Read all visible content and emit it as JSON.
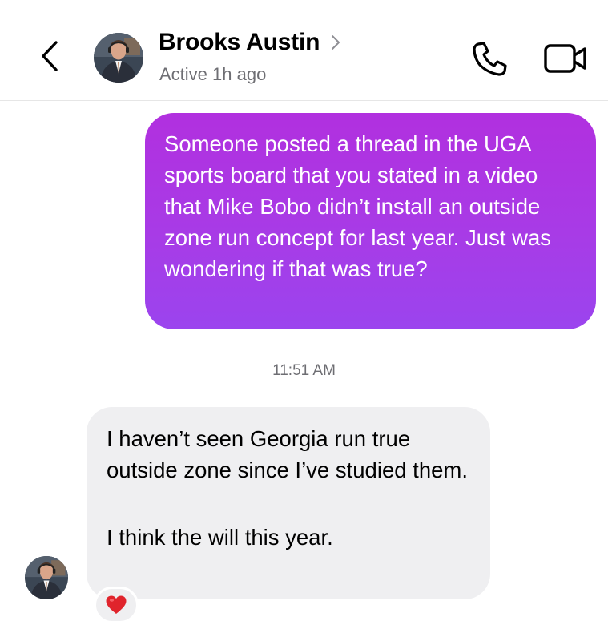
{
  "header": {
    "contact_name": "Brooks Austin",
    "status": "Active 1h ago",
    "icons": {
      "back": "chevron-left-icon",
      "profile": "chevron-right-icon",
      "call": "phone-icon",
      "video": "video-camera-icon"
    }
  },
  "messages": [
    {
      "direction": "sent",
      "text": "Someone posted a thread in the UGA sports board that you stated in a video that Mike Bobo didn’t install an outside zone run concept for last year. Just was wondering if that was true?"
    },
    {
      "direction": "received",
      "timestamp": "11:51 AM",
      "paragraphs": [
        "I haven’t seen Georgia run true outside zone since I’ve studied them.",
        "I think the will this year."
      ],
      "reaction": "❤️"
    }
  ],
  "colors": {
    "sent_bubble_top": "#b130df",
    "sent_bubble_bottom": "#9b44ee",
    "received_bubble": "#efeff1",
    "reaction_heart": "#e0242c",
    "secondary_text": "#6e6e73"
  }
}
